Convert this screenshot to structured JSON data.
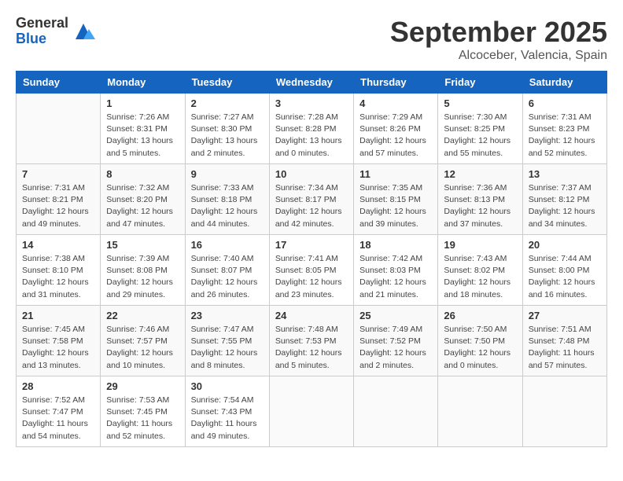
{
  "header": {
    "logo_general": "General",
    "logo_blue": "Blue",
    "month": "September 2025",
    "location": "Alcoceber, Valencia, Spain"
  },
  "weekdays": [
    "Sunday",
    "Monday",
    "Tuesday",
    "Wednesday",
    "Thursday",
    "Friday",
    "Saturday"
  ],
  "weeks": [
    [
      {
        "day": "",
        "info": ""
      },
      {
        "day": "1",
        "info": "Sunrise: 7:26 AM\nSunset: 8:31 PM\nDaylight: 13 hours\nand 5 minutes."
      },
      {
        "day": "2",
        "info": "Sunrise: 7:27 AM\nSunset: 8:30 PM\nDaylight: 13 hours\nand 2 minutes."
      },
      {
        "day": "3",
        "info": "Sunrise: 7:28 AM\nSunset: 8:28 PM\nDaylight: 13 hours\nand 0 minutes."
      },
      {
        "day": "4",
        "info": "Sunrise: 7:29 AM\nSunset: 8:26 PM\nDaylight: 12 hours\nand 57 minutes."
      },
      {
        "day": "5",
        "info": "Sunrise: 7:30 AM\nSunset: 8:25 PM\nDaylight: 12 hours\nand 55 minutes."
      },
      {
        "day": "6",
        "info": "Sunrise: 7:31 AM\nSunset: 8:23 PM\nDaylight: 12 hours\nand 52 minutes."
      }
    ],
    [
      {
        "day": "7",
        "info": "Sunrise: 7:31 AM\nSunset: 8:21 PM\nDaylight: 12 hours\nand 49 minutes."
      },
      {
        "day": "8",
        "info": "Sunrise: 7:32 AM\nSunset: 8:20 PM\nDaylight: 12 hours\nand 47 minutes."
      },
      {
        "day": "9",
        "info": "Sunrise: 7:33 AM\nSunset: 8:18 PM\nDaylight: 12 hours\nand 44 minutes."
      },
      {
        "day": "10",
        "info": "Sunrise: 7:34 AM\nSunset: 8:17 PM\nDaylight: 12 hours\nand 42 minutes."
      },
      {
        "day": "11",
        "info": "Sunrise: 7:35 AM\nSunset: 8:15 PM\nDaylight: 12 hours\nand 39 minutes."
      },
      {
        "day": "12",
        "info": "Sunrise: 7:36 AM\nSunset: 8:13 PM\nDaylight: 12 hours\nand 37 minutes."
      },
      {
        "day": "13",
        "info": "Sunrise: 7:37 AM\nSunset: 8:12 PM\nDaylight: 12 hours\nand 34 minutes."
      }
    ],
    [
      {
        "day": "14",
        "info": "Sunrise: 7:38 AM\nSunset: 8:10 PM\nDaylight: 12 hours\nand 31 minutes."
      },
      {
        "day": "15",
        "info": "Sunrise: 7:39 AM\nSunset: 8:08 PM\nDaylight: 12 hours\nand 29 minutes."
      },
      {
        "day": "16",
        "info": "Sunrise: 7:40 AM\nSunset: 8:07 PM\nDaylight: 12 hours\nand 26 minutes."
      },
      {
        "day": "17",
        "info": "Sunrise: 7:41 AM\nSunset: 8:05 PM\nDaylight: 12 hours\nand 23 minutes."
      },
      {
        "day": "18",
        "info": "Sunrise: 7:42 AM\nSunset: 8:03 PM\nDaylight: 12 hours\nand 21 minutes."
      },
      {
        "day": "19",
        "info": "Sunrise: 7:43 AM\nSunset: 8:02 PM\nDaylight: 12 hours\nand 18 minutes."
      },
      {
        "day": "20",
        "info": "Sunrise: 7:44 AM\nSunset: 8:00 PM\nDaylight: 12 hours\nand 16 minutes."
      }
    ],
    [
      {
        "day": "21",
        "info": "Sunrise: 7:45 AM\nSunset: 7:58 PM\nDaylight: 12 hours\nand 13 minutes."
      },
      {
        "day": "22",
        "info": "Sunrise: 7:46 AM\nSunset: 7:57 PM\nDaylight: 12 hours\nand 10 minutes."
      },
      {
        "day": "23",
        "info": "Sunrise: 7:47 AM\nSunset: 7:55 PM\nDaylight: 12 hours\nand 8 minutes."
      },
      {
        "day": "24",
        "info": "Sunrise: 7:48 AM\nSunset: 7:53 PM\nDaylight: 12 hours\nand 5 minutes."
      },
      {
        "day": "25",
        "info": "Sunrise: 7:49 AM\nSunset: 7:52 PM\nDaylight: 12 hours\nand 2 minutes."
      },
      {
        "day": "26",
        "info": "Sunrise: 7:50 AM\nSunset: 7:50 PM\nDaylight: 12 hours\nand 0 minutes."
      },
      {
        "day": "27",
        "info": "Sunrise: 7:51 AM\nSunset: 7:48 PM\nDaylight: 11 hours\nand 57 minutes."
      }
    ],
    [
      {
        "day": "28",
        "info": "Sunrise: 7:52 AM\nSunset: 7:47 PM\nDaylight: 11 hours\nand 54 minutes."
      },
      {
        "day": "29",
        "info": "Sunrise: 7:53 AM\nSunset: 7:45 PM\nDaylight: 11 hours\nand 52 minutes."
      },
      {
        "day": "30",
        "info": "Sunrise: 7:54 AM\nSunset: 7:43 PM\nDaylight: 11 hours\nand 49 minutes."
      },
      {
        "day": "",
        "info": ""
      },
      {
        "day": "",
        "info": ""
      },
      {
        "day": "",
        "info": ""
      },
      {
        "day": "",
        "info": ""
      }
    ]
  ]
}
